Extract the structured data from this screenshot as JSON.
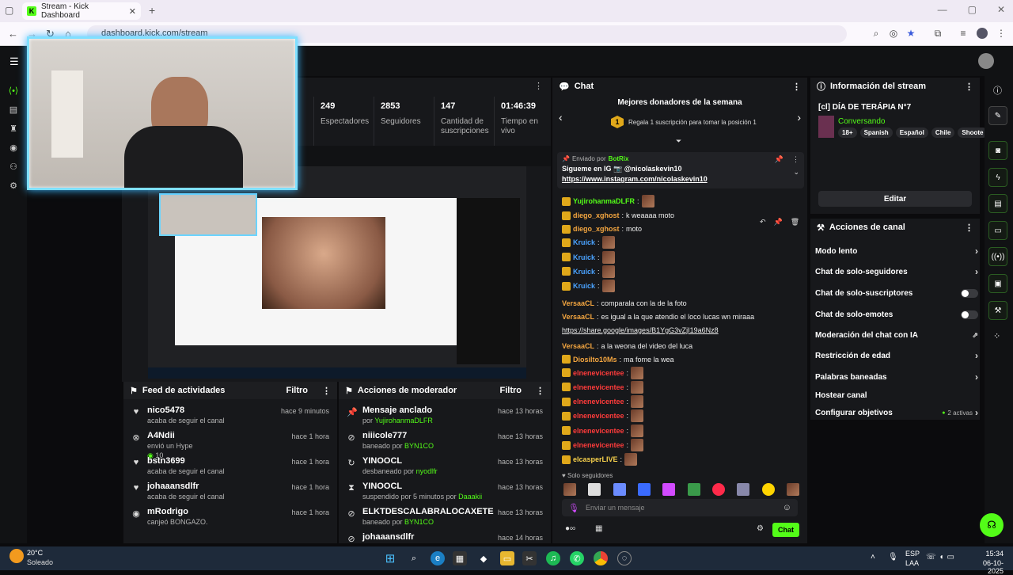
{
  "browser": {
    "tab_title": "Stream - Kick Dashboard",
    "url": "dashboard.kick.com/stream"
  },
  "stats": [
    {
      "value": "249",
      "label": "Espectadores"
    },
    {
      "value": "2853",
      "label": "Seguidores"
    },
    {
      "value": "147",
      "label": "Cantidad de suscripciones"
    },
    {
      "value": "01:46:39",
      "label": "Tiempo en vivo"
    }
  ],
  "feed": {
    "title": "Feed de actividades",
    "filter": "Filtro",
    "items": [
      {
        "name": "nico5478",
        "detail": "acaba de seguir el canal",
        "time": "hace 9 minutos",
        "icon": "heart-icon"
      },
      {
        "name": "A4Ndii",
        "detail": "envió un Hype",
        "extra": "10",
        "time": "hace 1 hora",
        "icon": "kick-icon"
      },
      {
        "name": "bstn3699",
        "detail": "acaba de seguir el canal",
        "time": "hace 1 hora",
        "icon": "heart-icon"
      },
      {
        "name": "johaaansdlfr",
        "detail": "acaba de seguir el canal",
        "time": "hace 1 hora",
        "icon": "heart-icon"
      },
      {
        "name": "mRodrigo",
        "detail": "canjeó BONGAZO.",
        "time": "hace 1 hora",
        "icon": "gift-icon"
      }
    ]
  },
  "modactions": {
    "title": "Acciones de moderador",
    "filter": "Filtro",
    "items": [
      {
        "name": "Mensaje anclado",
        "detail_prefix": "por ",
        "detail_user": "YujirohanmaDLFR",
        "time": "hace 13 horas"
      },
      {
        "name": "niiicole777",
        "detail_prefix": "baneado por ",
        "detail_user": "BYN1CO",
        "time": "hace 13 horas"
      },
      {
        "name": "YINOOCL",
        "detail_prefix": "desbaneado por ",
        "detail_user": "nyodlfr",
        "time": "hace 13 horas"
      },
      {
        "name": "YINOOCL",
        "detail_prefix": "suspendido por 5 minutos por ",
        "detail_user": "Daaakii",
        "time": "hace 13 horas"
      },
      {
        "name": "ELKTDESCALABRALOCAXETE",
        "detail_prefix": "baneado por ",
        "detail_user": "BYN1CO",
        "time": "hace 13 horas"
      },
      {
        "name": "johaaansdlfr",
        "detail_prefix": "",
        "detail_user": "",
        "time": "hace 14 horas"
      }
    ]
  },
  "chat": {
    "title": "Chat",
    "donors_title": "Mejores donadores de la semana",
    "donors_rank": "1",
    "donors_cta": "Regala 1 suscripción para tomar la posición 1",
    "pinned": {
      "sent_by_label": "Enviado por",
      "sender": "BotRix",
      "line1": "Sigueme en IG 📷 @nicolaskevin10",
      "link": "https://www.instagram.com/nicolaskevin10"
    },
    "messages": [
      {
        "user": "YujirohanmaDLFR",
        "text": "",
        "cls": "u-green"
      },
      {
        "user": "diego_xghost",
        "text": "k weaaaa moto",
        "cls": "u-orange"
      },
      {
        "user": "diego_xghost",
        "text": "moto",
        "cls": "u-orange"
      },
      {
        "user": "Kruick",
        "text": "",
        "cls": "u-blue"
      },
      {
        "user": "Kruick",
        "text": "",
        "cls": "u-blue"
      },
      {
        "user": "Kruick",
        "text": "",
        "cls": "u-blue"
      },
      {
        "user": "Kruick",
        "text": "",
        "cls": "u-blue"
      },
      {
        "user": "VersaaCL",
        "text": "comparala con la de la foto",
        "cls": "u-orange"
      },
      {
        "user": "VersaaCL",
        "text": "es igual a la que atendio el loco lucas wn miraaa",
        "cls": "u-orange"
      },
      {
        "user": "",
        "text": "https://share.google/images/B1YgG3vZjI19a6Nz8",
        "cls": ""
      },
      {
        "user": "VersaaCL",
        "text": "a la weona del video del luca",
        "cls": "u-orange"
      },
      {
        "user": "Diosilto10Ms",
        "text": "ma fome la wea",
        "cls": "u-orange"
      },
      {
        "user": "elnenevicentee",
        "text": "",
        "cls": "u-red"
      },
      {
        "user": "elnenevicentee",
        "text": "",
        "cls": "u-red"
      },
      {
        "user": "elnenevicentee",
        "text": "",
        "cls": "u-red"
      },
      {
        "user": "elnenevicentee",
        "text": "",
        "cls": "u-red"
      },
      {
        "user": "elnenevicentee",
        "text": "",
        "cls": "u-red"
      },
      {
        "user": "elnenevicentee",
        "text": "",
        "cls": "u-red"
      },
      {
        "user": "elcasperLIVE",
        "text": "",
        "cls": "u-yellow"
      }
    ],
    "followers_only": "Solo seguidores",
    "input_placeholder": "Enviar un mensaje",
    "send_label": "Chat"
  },
  "streaminfo": {
    "title": "Información del stream",
    "stream_title": "[cl] DÍA DE TERÁPIA N°7",
    "category": "Conversando",
    "tags": [
      "18+",
      "Spanish",
      "Español",
      "Chile",
      "Shoote"
    ],
    "edit_label": "Editar"
  },
  "channel": {
    "title": "Acciones de canal",
    "items": [
      {
        "label": "Modo lento",
        "type": "chevron"
      },
      {
        "label": "Chat de solo-seguidores",
        "type": "chevron"
      },
      {
        "label": "Chat de solo-suscriptores",
        "type": "toggle"
      },
      {
        "label": "Chat de solo-emotes",
        "type": "toggle"
      },
      {
        "label": "Moderación del chat con IA",
        "type": "external"
      },
      {
        "label": "Restricción de edad",
        "type": "chevron"
      },
      {
        "label": "Palabras baneadas",
        "type": "chevron"
      },
      {
        "label": "Hostear canal",
        "type": "none"
      },
      {
        "label": "Configurar objetivos",
        "type": "goals",
        "extra": "2 activas"
      }
    ]
  },
  "taskbar": {
    "weather_temp": "20°C",
    "weather_desc": "Soleado",
    "lang": "ESP",
    "lang2": "LAA",
    "time": "15:34",
    "date": "06-10-2025"
  }
}
